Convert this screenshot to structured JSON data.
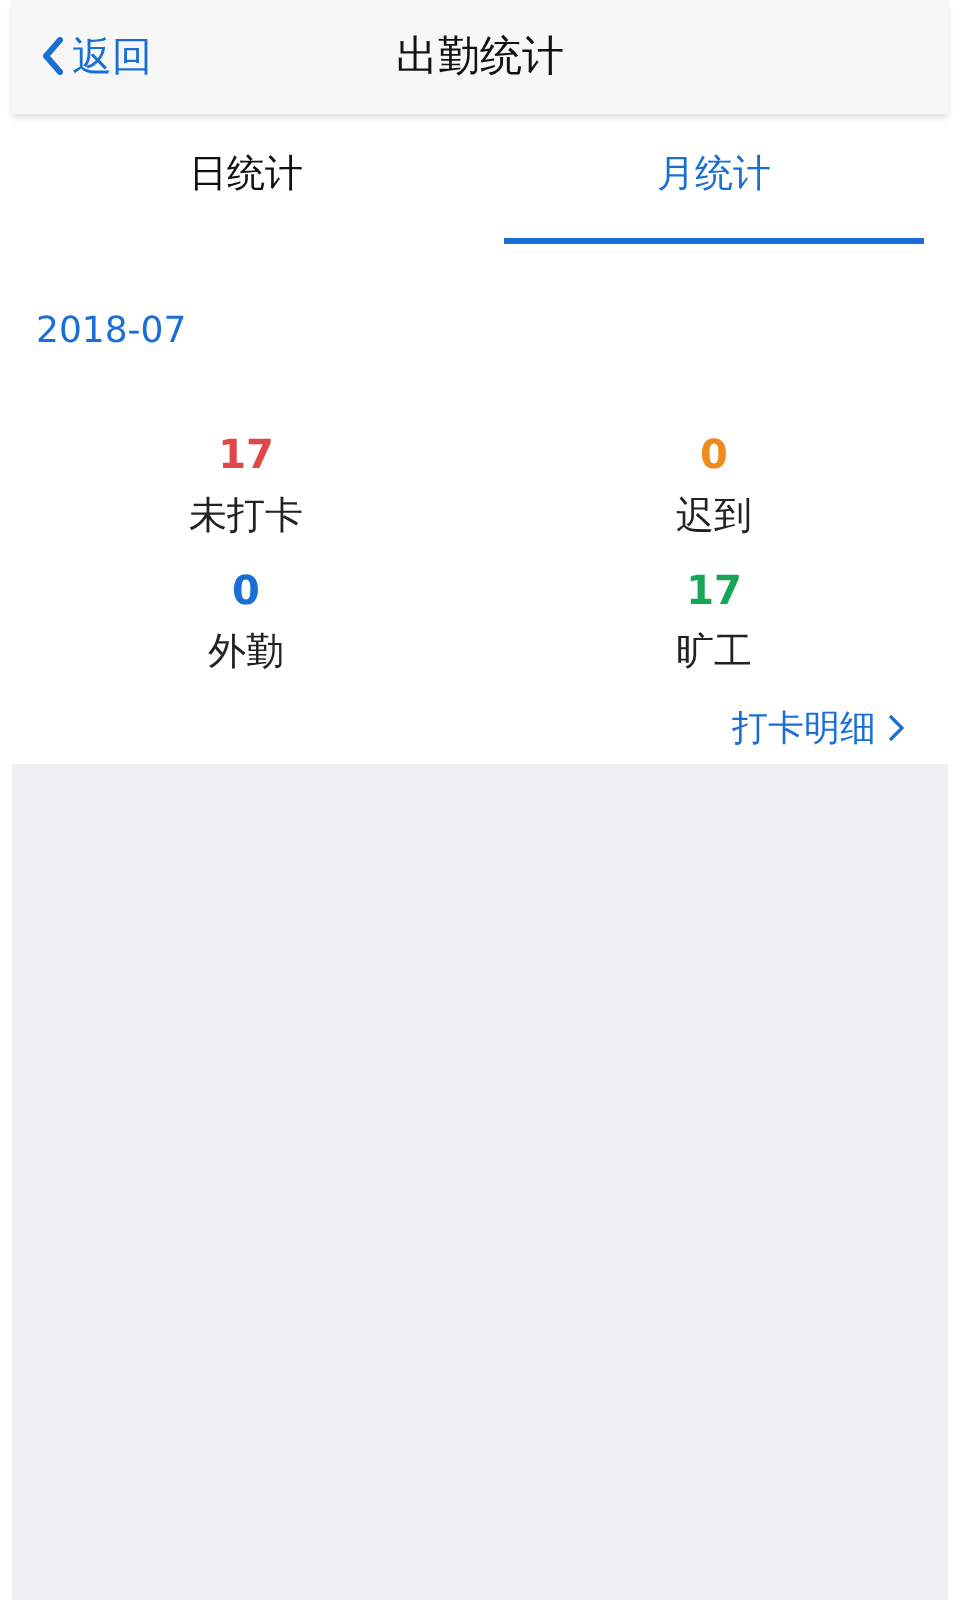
{
  "header": {
    "back": "返回",
    "title": "出勤统计"
  },
  "tabs": [
    {
      "label": "日统计",
      "selected": false
    },
    {
      "label": "月统计",
      "selected": true
    }
  ],
  "month": "2018-07",
  "stats": [
    {
      "value": "17",
      "label": "未打卡",
      "color": "#e04848"
    },
    {
      "value": "0",
      "label": "迟到",
      "color": "#f08a1c"
    },
    {
      "value": "0",
      "label": "外勤",
      "color": "#1a6fd6"
    },
    {
      "value": "17",
      "label": "旷工",
      "color": "#17a557"
    }
  ],
  "detail_link": "打卡明细"
}
